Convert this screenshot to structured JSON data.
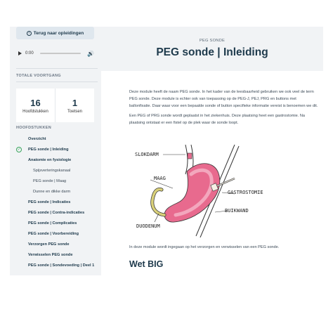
{
  "sidebar": {
    "back_label": "Terug naar opleidingen",
    "audio": {
      "time": "0:00"
    },
    "progress_heading": "TOTALE VOORTGANG",
    "stats": [
      {
        "value": "16",
        "label": "Hoofdstukken"
      },
      {
        "value": "1",
        "label": "Toetsen"
      }
    ],
    "chapters_heading": "HOOFDSTUKKEN",
    "items": [
      {
        "label": "Overzicht"
      },
      {
        "label": "PEG sonde | Inleiding"
      },
      {
        "label": "Anatomie en fysiologie"
      },
      {
        "label": "Spijsverteringskanaal"
      },
      {
        "label": "PEG sonde | Maag"
      },
      {
        "label": "Dunne en dikke darm"
      },
      {
        "label": "PEG sonde | Indicaties"
      },
      {
        "label": "PEG sonde | Contra-indicaties"
      },
      {
        "label": "PEG sonde | Complicaties"
      },
      {
        "label": "PEG sonde | Voorbereiding"
      },
      {
        "label": "Verzorgen PEG sonde"
      },
      {
        "label": "Verwisselen PEG sonde"
      },
      {
        "label": "PEG sonde | Sondevoeding | Deel 1"
      }
    ]
  },
  "header": {
    "kicker": "PEG SONDE",
    "title": "PEG sonde | Inleiding"
  },
  "content": {
    "paragraph_1": "Deze module heeft de naam PEG sonde. In het kader van de leesbaarheid gebruiken we ook veel de term PEG sonde. Deze module is echter ook van toepassing op de PEG-J, PEJ, PRG en buttons met ballonfixatie. Daar waar voor een bepaalde sonde of button specifieke informatie vereist is benoemen we dit.",
    "paragraph_2": "Een PEG of PRG sonde wordt geplaatst in het ziekenhuis. Deze plaatsing heet een gastrostomie. Na plaatsing ontstaat er een fistel op de plek waar de sonde loopt.",
    "figure_labels": {
      "slokdarm": "SLOKDARM",
      "maag": "MAAG",
      "gastrostomie": "GASTROSTOMIE",
      "buikwand": "BUIKWAND",
      "duodenum": "DUODENUM"
    },
    "paragraph_3": "In deze module wordt ingegaan op het verzorgen en verwisselen van een PEG sonde.",
    "heading_2": "Wet BIG"
  },
  "colors": {
    "navy": "#1e3a4c",
    "sidebar_bg": "#f1f3f5",
    "stomach": "#e86a8e",
    "check_green": "#3aa55d"
  }
}
